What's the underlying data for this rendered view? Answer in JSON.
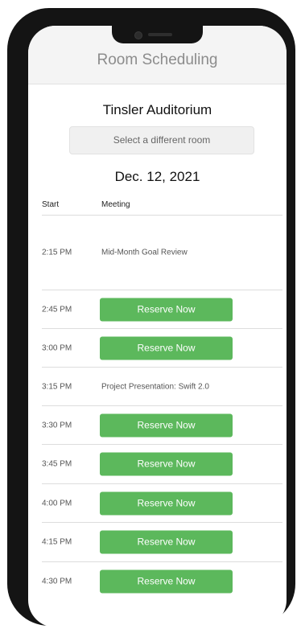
{
  "header": {
    "title": "Room Scheduling"
  },
  "room": {
    "name": "Tinsler Auditorium",
    "select_label": "Select a different room"
  },
  "date": "Dec. 12, 2021",
  "table": {
    "columns": [
      "Start",
      "Meeting"
    ],
    "rows": [
      {
        "time": "2:15 PM",
        "meeting": "Mid-Month Goal Review"
      },
      {
        "time": "2:45 PM",
        "action": "Reserve Now"
      },
      {
        "time": "3:00 PM",
        "action": "Reserve Now"
      },
      {
        "time": "3:15 PM",
        "meeting": "Project Presentation: Swift 2.0"
      },
      {
        "time": "3:30 PM",
        "action": "Reserve Now"
      },
      {
        "time": "3:45 PM",
        "action": "Reserve Now"
      },
      {
        "time": "4:00 PM",
        "action": "Reserve Now"
      },
      {
        "time": "4:15 PM",
        "action": "Reserve Now"
      },
      {
        "time": "4:30 PM",
        "action": "Reserve Now"
      }
    ]
  },
  "colors": {
    "accent": "#5cb85c",
    "header_bg": "#f4f4f4",
    "device": "#141414"
  }
}
